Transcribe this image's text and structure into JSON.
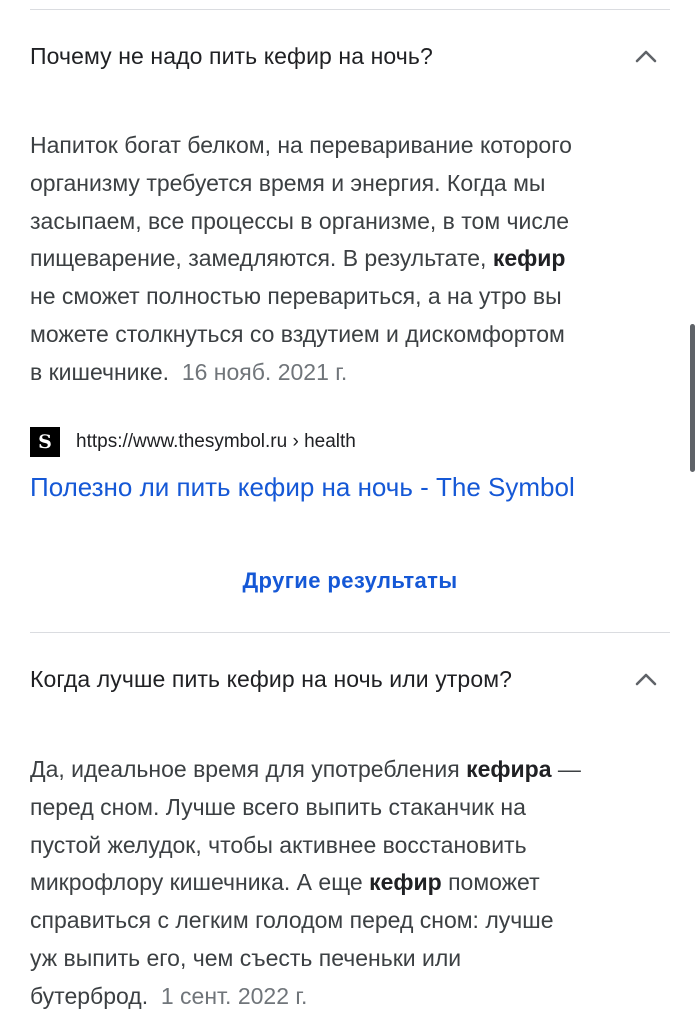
{
  "faq": [
    {
      "question": "Почему не надо пить кефир на ночь?",
      "answer_lines": [
        {
          "text": "Напиток богат белком, на переваривание которого"
        },
        {
          "text": "организму требуется время и энергия. Когда мы"
        },
        {
          "text": "засыпаем, все процессы в организме, в том числе"
        },
        {
          "text": "пищеварение, замедляются. В результате, ",
          "bold": "кефир"
        },
        {
          "text": "не сможет полностью перевариться, а на утро вы"
        },
        {
          "text": "можете столкнуться со вздутием и дискомфортом"
        },
        {
          "text": "в кишечнике."
        }
      ],
      "date": "16 нояб. 2021 г.",
      "source": {
        "favicon_letter": "S",
        "url": "https://www.thesymbol.ru › health",
        "title": "Полезно ли пить кефир на ночь",
        "separator": " - ",
        "site": "The Symbol"
      }
    },
    {
      "question": "Когда лучше пить кефир на ночь или утром?",
      "answer_lines": [
        {
          "text": "Да, идеальное время для употребления ",
          "bold": "кефира",
          "after": " —"
        },
        {
          "text": "перед сном. Лучше всего выпить стаканчик на"
        },
        {
          "text": "пустой желудок, чтобы активнее восстановить"
        },
        {
          "text": "микрофлору кишечника. А еще ",
          "bold": "кефир",
          "after": " поможет"
        },
        {
          "text": "справиться с легким голодом перед сном: лучше"
        },
        {
          "text": "уж выпить его, чем съесть печеньки или"
        },
        {
          "text": "бутерброд."
        }
      ],
      "date": "1 сент. 2022 г."
    }
  ],
  "more_results_label": "Другие результаты",
  "icons": {
    "chevron": "chevron-up-icon"
  },
  "colors": {
    "link": "#1558d6",
    "text": "#202124",
    "muted": "#70757a",
    "divider": "#dadce0"
  }
}
